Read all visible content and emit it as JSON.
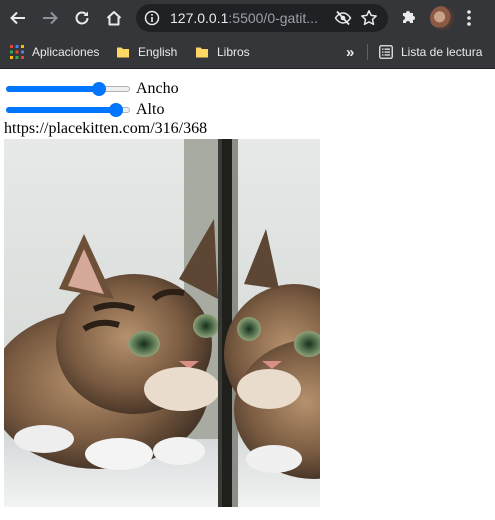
{
  "browser": {
    "url_host": "127.0.0.1",
    "url_rest": ":5500/0-gatit...",
    "bookmarks": [
      {
        "label": "Aplicaciones",
        "icon": "apps-grid-icon"
      },
      {
        "label": "English",
        "icon": "folder-icon"
      },
      {
        "label": "Libros",
        "icon": "folder-icon"
      }
    ],
    "overflow_label": "»",
    "reading_list_label": "Lista de lectura"
  },
  "page": {
    "sliders": [
      {
        "label": "Ancho",
        "value_fraction": 0.77
      },
      {
        "label": "Alto",
        "value_fraction": 0.92
      }
    ],
    "image_url_text": "https://placekitten.com/316/368",
    "image_alt": "kitten"
  },
  "colors": {
    "chrome_bg": "#35363a",
    "omnibox_bg": "#202124",
    "slider_accent": "#0075ff"
  }
}
